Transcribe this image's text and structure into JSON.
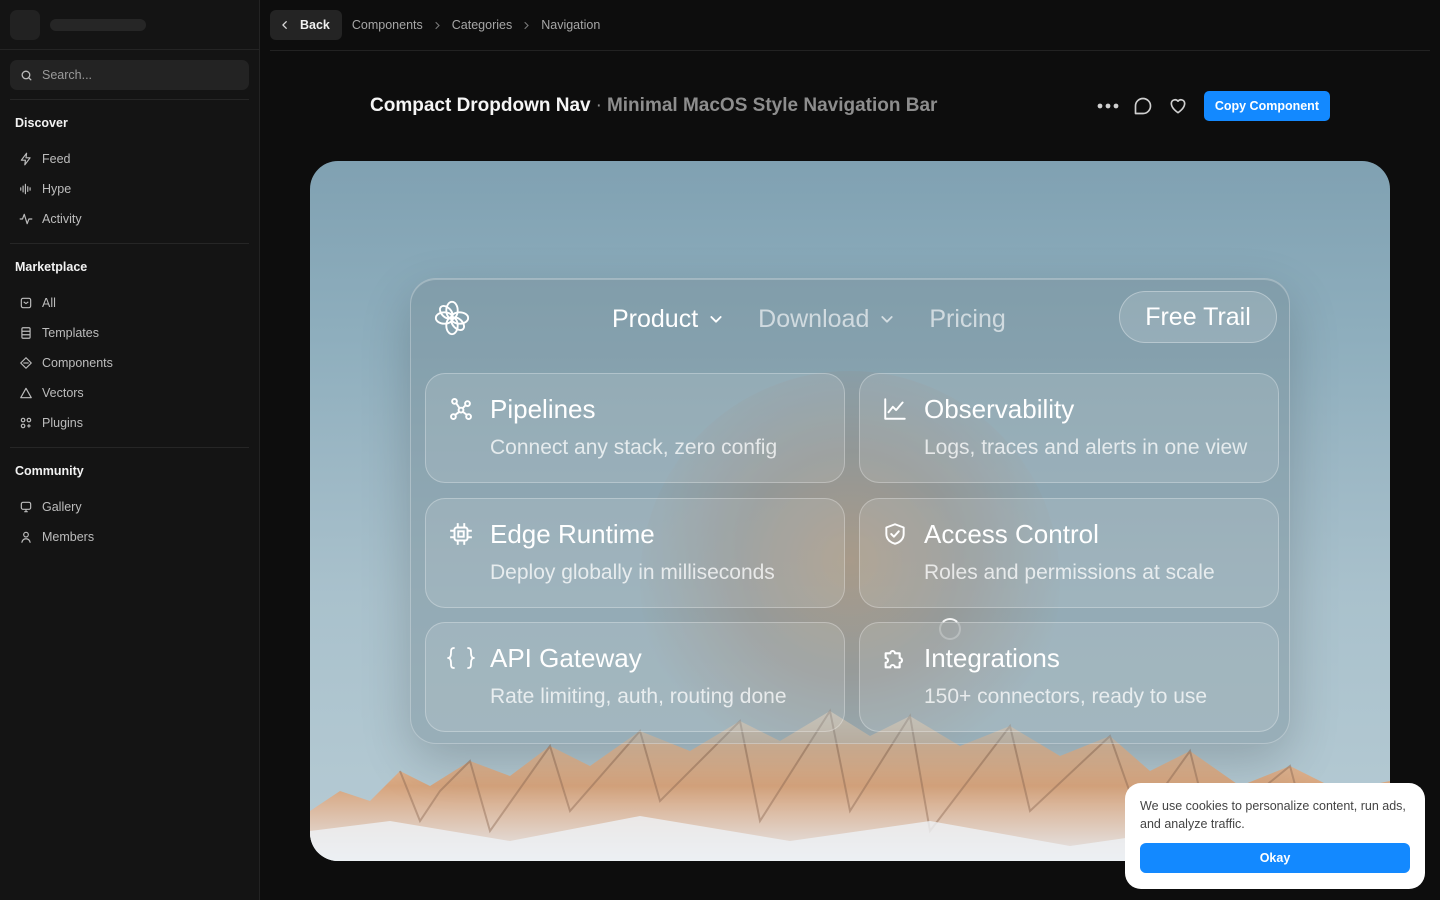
{
  "sidebar": {
    "search_placeholder": "Search...",
    "sections": [
      {
        "heading": "Discover",
        "items": [
          {
            "label": "Feed",
            "icon": "bolt-icon"
          },
          {
            "label": "Hype",
            "icon": "soundwave-icon"
          },
          {
            "label": "Activity",
            "icon": "pulse-icon"
          }
        ]
      },
      {
        "heading": "Marketplace",
        "items": [
          {
            "label": "All",
            "icon": "box-icon"
          },
          {
            "label": "Templates",
            "icon": "template-icon"
          },
          {
            "label": "Components",
            "icon": "diamond-icon"
          },
          {
            "label": "Vectors",
            "icon": "triangle-icon"
          },
          {
            "label": "Plugins",
            "icon": "plugins-icon"
          }
        ]
      },
      {
        "heading": "Community",
        "items": [
          {
            "label": "Gallery",
            "icon": "monitor-icon"
          },
          {
            "label": "Members",
            "icon": "user-icon"
          }
        ]
      }
    ]
  },
  "header": {
    "back_label": "Back",
    "breadcrumbs": [
      "Components",
      "Categories",
      "Navigation"
    ]
  },
  "title": {
    "main": "Compact Dropdown Nav",
    "separator": "·",
    "sub": "Minimal MacOS Style Navigation Bar",
    "copy_label": "Copy Component"
  },
  "preview": {
    "nav_links": [
      {
        "label": "Product",
        "dropdown": true,
        "active": true
      },
      {
        "label": "Download",
        "dropdown": true,
        "active": false
      },
      {
        "label": "Pricing",
        "dropdown": false,
        "active": false
      }
    ],
    "cta": "Free Trail",
    "tiles": [
      {
        "title": "Pipelines",
        "desc": "Connect any stack, zero config",
        "icon": "pipeline-icon"
      },
      {
        "title": "Observability",
        "desc": "Logs, traces and alerts in one view",
        "icon": "chart-line-icon"
      },
      {
        "title": "Edge Runtime",
        "desc": "Deploy globally in milliseconds",
        "icon": "chip-icon"
      },
      {
        "title": "Access Control",
        "desc": "Roles and permissions at scale",
        "icon": "shield-check-icon"
      },
      {
        "title": "API Gateway",
        "desc": "Rate limiting, auth, routing done",
        "icon": "braces-icon"
      },
      {
        "title": "Integrations",
        "desc": "150+ connectors, ready to use",
        "icon": "puzzle-icon"
      }
    ]
  },
  "cookie": {
    "text": "We use cookies to personalize content, run ads, and analyze traffic.",
    "button": "Okay"
  },
  "colors": {
    "accent": "#1389ff",
    "background": "#0d0d0d",
    "sidebar": "#141414"
  }
}
